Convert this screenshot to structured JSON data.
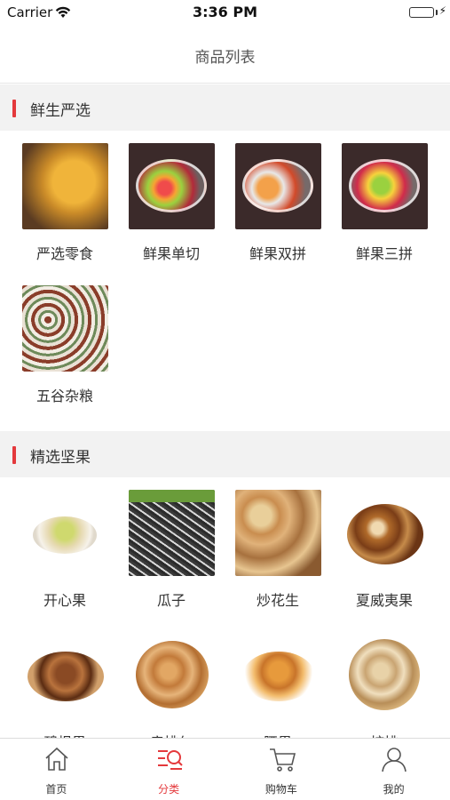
{
  "status_bar": {
    "carrier": "Carrier",
    "time": "3:36 PM",
    "battery_level": 1.0
  },
  "nav": {
    "title": "商品列表"
  },
  "sections": [
    {
      "title": "鲜生严选",
      "items": [
        {
          "label": "严选零食",
          "image": "snack-image"
        },
        {
          "label": "鲜果单切",
          "image": "fruit-bowl-image"
        },
        {
          "label": "鲜果双拼",
          "image": "fruit-bowl-image"
        },
        {
          "label": "鲜果三拼",
          "image": "fruit-bowl-image"
        },
        {
          "label": "五谷杂粮",
          "image": "grain-image"
        }
      ]
    },
    {
      "title": "精选坚果",
      "items": [
        {
          "label": "开心果",
          "image": "pistachio-image"
        },
        {
          "label": "瓜子",
          "image": "sunflower-seed-image"
        },
        {
          "label": "炒花生",
          "image": "peanut-image"
        },
        {
          "label": "夏威夷果",
          "image": "macadamia-image"
        },
        {
          "label": "碧根果",
          "image": "pecan-image"
        },
        {
          "label": "扁桃仁",
          "image": "almond-image"
        },
        {
          "label": "腰果",
          "image": "cashew-image"
        },
        {
          "label": "核桃",
          "image": "walnut-image"
        }
      ]
    }
  ],
  "tab_bar": {
    "active": "分类",
    "items": [
      {
        "label": "首页",
        "icon": "home-icon"
      },
      {
        "label": "分类",
        "icon": "category-icon"
      },
      {
        "label": "购物车",
        "icon": "cart-icon"
      },
      {
        "label": "我的",
        "icon": "profile-icon"
      }
    ]
  },
  "colors": {
    "accent": "#e4393c",
    "section_bg": "#f2f2f2"
  }
}
